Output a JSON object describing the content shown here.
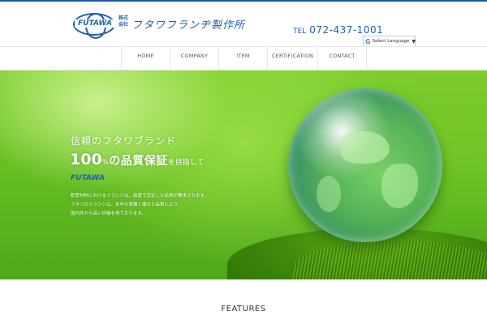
{
  "header": {
    "logo_mark": "FUTAWA",
    "logo_kk_1": "株式",
    "logo_kk_2": "会社",
    "logo_name": "フタワフランヂ製作所",
    "tel_label": "TEL",
    "tel_number": "072-437-1001",
    "translate": {
      "label": "Select Language",
      "arrow": "▼",
      "g_icon": "G"
    }
  },
  "nav": {
    "items": [
      {
        "label": "HOME"
      },
      {
        "label": "COMPANY"
      },
      {
        "label": "ITEM"
      },
      {
        "label": "CERTIFICATION"
      },
      {
        "label": "CONTACT"
      }
    ]
  },
  "hero": {
    "title": "信頼のフタワブランド",
    "head_num": "100",
    "head_pct": "%",
    "head_text": "の品質保証",
    "head_tail": "を目指して",
    "brand": "FUTAWA",
    "desc": [
      "配管材料におけるフランジは、高度で安定した品質が要求されます。",
      "フタワのフランジは、永年の実績と優れた品質により、",
      "国内外から高い評価を得ております。"
    ]
  },
  "features": {
    "title": "FEATURES"
  },
  "colors": {
    "brand_blue": "#1f5fae",
    "nav_text": "#555555",
    "hero_green": "#66bf22"
  }
}
